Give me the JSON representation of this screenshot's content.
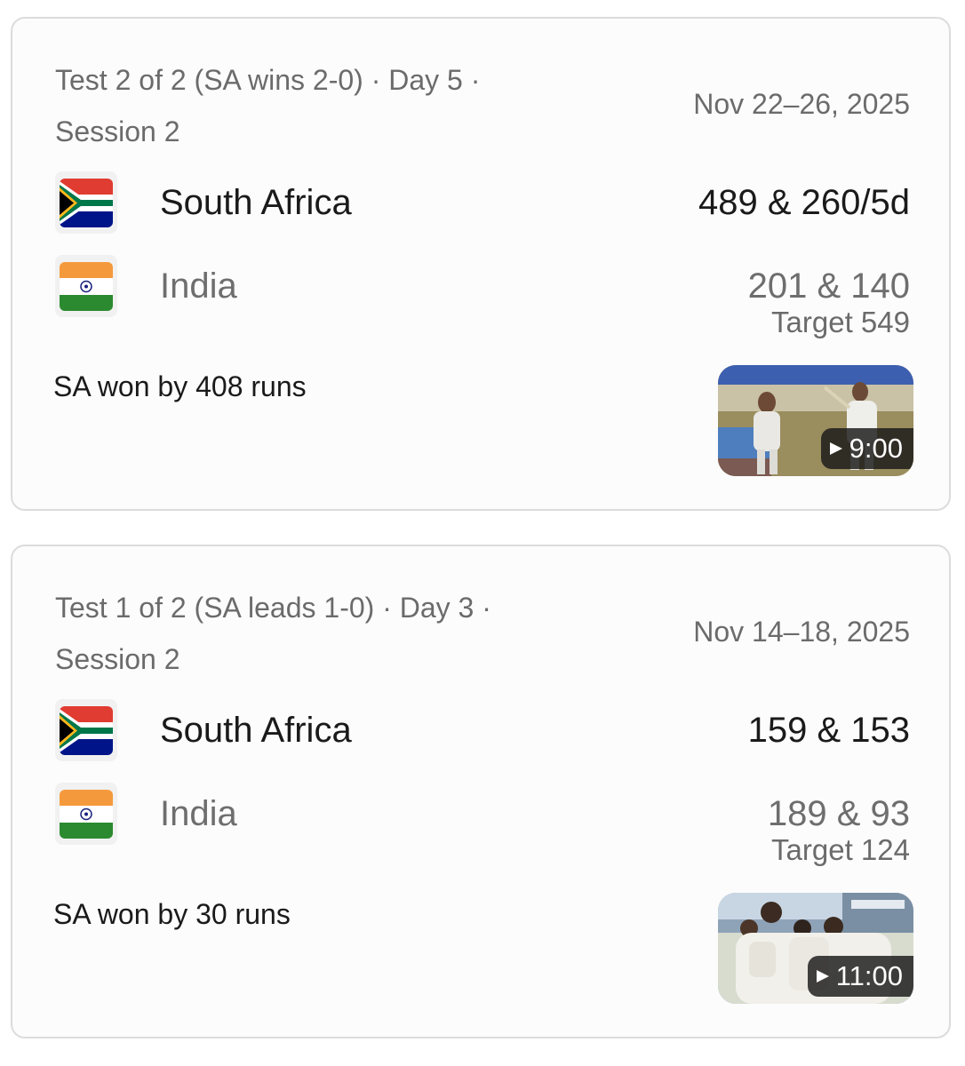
{
  "matches": [
    {
      "series_info_line1": "Test 2 of 2 (SA wins 2-0) · Day 5 ·",
      "series_info_line2": "Session 2",
      "dates": "Nov 22–26, 2025",
      "team1": {
        "name": "South Africa",
        "score": "489 & 260/5d",
        "flag_icon": "south-africa-flag-icon"
      },
      "team2": {
        "name": "India",
        "score": "201 & 140",
        "flag_icon": "india-flag-icon"
      },
      "target": "Target 549",
      "result": "SA won by 408 runs",
      "video": {
        "duration": "9:00",
        "icon": "play-icon"
      }
    },
    {
      "series_info_line1": "Test 1 of 2 (SA leads 1-0) · Day 3 ·",
      "series_info_line2": "Session 2",
      "dates": "Nov 14–18, 2025",
      "team1": {
        "name": "South Africa",
        "score": "159 & 153",
        "flag_icon": "south-africa-flag-icon"
      },
      "team2": {
        "name": "India",
        "score": "189 & 93",
        "flag_icon": "india-flag-icon"
      },
      "target": "Target 124",
      "result": "SA won by 30 runs",
      "video": {
        "duration": "11:00",
        "icon": "play-icon"
      }
    }
  ],
  "colors": {
    "primary_text": "#1a1a1a",
    "secondary_text": "#6b6b6b",
    "card_border": "#dcdcdc",
    "card_background": "#fcfcfc"
  }
}
